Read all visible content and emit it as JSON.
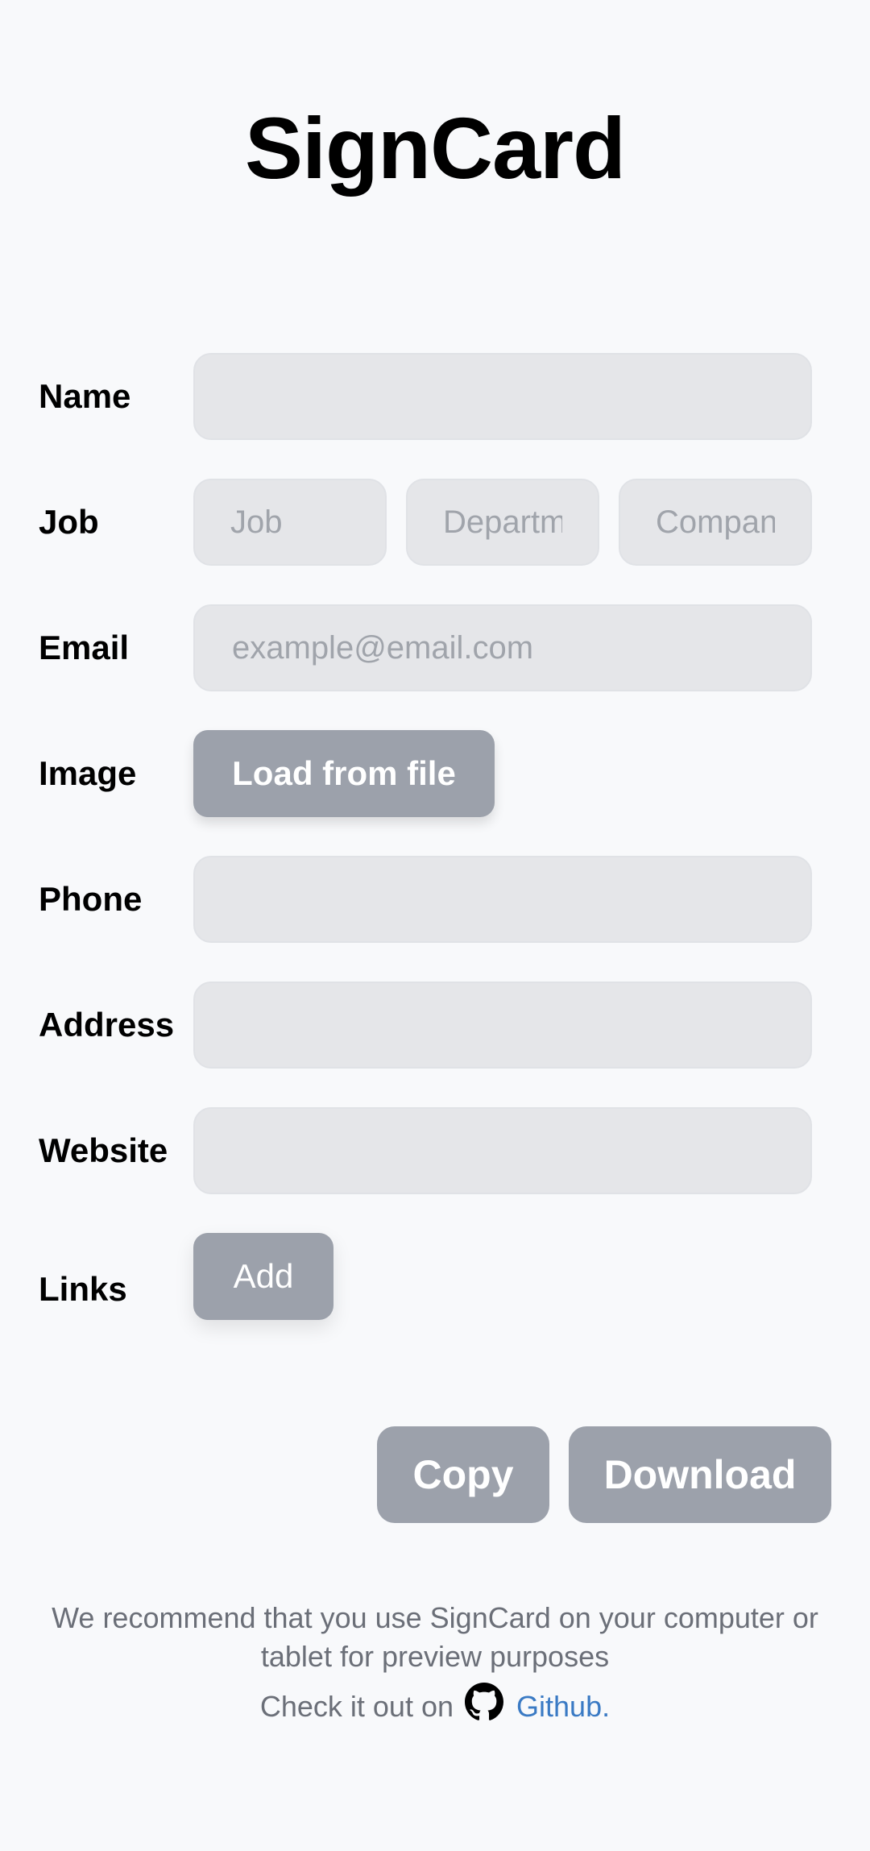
{
  "app": {
    "title": "SignCard"
  },
  "form": {
    "name": {
      "label": "Name",
      "value": "",
      "placeholder": ""
    },
    "job": {
      "label": "Job",
      "job_placeholder": "Job",
      "department_placeholder": "Department",
      "company_placeholder": "Company"
    },
    "email": {
      "label": "Email",
      "placeholder": "example@email.com"
    },
    "image": {
      "label": "Image",
      "button_label": "Load from file"
    },
    "phone": {
      "label": "Phone",
      "value": ""
    },
    "address": {
      "label": "Address",
      "value": ""
    },
    "website": {
      "label": "Website",
      "value": ""
    },
    "links": {
      "label": "Links",
      "button_label": "Add"
    }
  },
  "actions": {
    "copy_label": "Copy",
    "download_label": "Download"
  },
  "footer": {
    "recommendation": "We recommend that you use SignCard on your computer or tablet for preview purposes",
    "check_prefix": "Check it out on",
    "link_label": "Github",
    "link_suffix": ".",
    "icon": "github-icon"
  },
  "colors": {
    "background": "#f8f9fb",
    "input_bg": "#e5e6e9",
    "button_bg": "#9ca1ab",
    "link": "#3a7ac4",
    "muted_text": "#6b6f78"
  }
}
